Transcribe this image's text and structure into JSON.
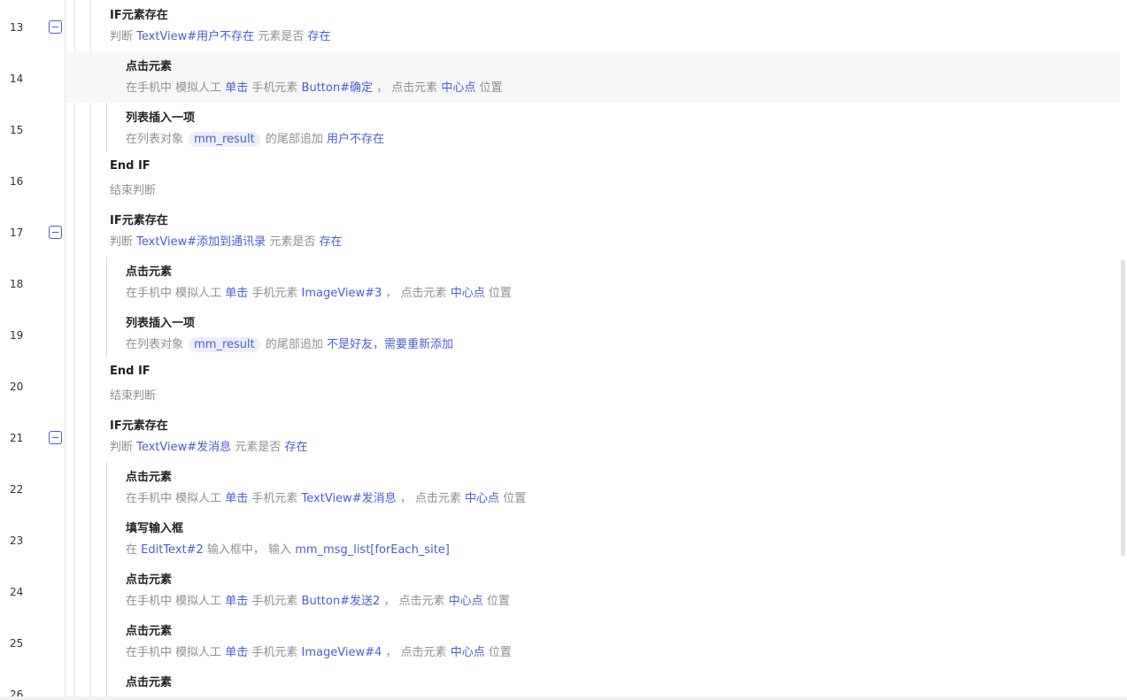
{
  "rows": [
    {
      "line": "13",
      "title": "IF元素存在",
      "desc": [
        [
          "判断 ",
          ""
        ],
        [
          "TextView#用户不存在",
          "k"
        ],
        [
          " 元素是否 ",
          ""
        ],
        [
          "存在",
          "k"
        ]
      ],
      "fold": true
    },
    {
      "line": "14",
      "title": "点击元素",
      "desc": [
        [
          "在手机中 模拟人工 ",
          ""
        ],
        [
          "单击",
          "k"
        ],
        [
          " 手机元素 ",
          ""
        ],
        [
          "Button#确定",
          "k"
        ],
        [
          " ， 点击元素 ",
          ""
        ],
        [
          "中心点",
          "k"
        ],
        [
          " 位置",
          ""
        ]
      ]
    },
    {
      "line": "15",
      "title": "列表插入一项",
      "desc": [
        [
          "在列表对象 ",
          ""
        ],
        [
          "mm_result",
          "chip"
        ],
        [
          " 的尾部追加 ",
          ""
        ],
        [
          "用户不存在",
          "k"
        ]
      ]
    },
    {
      "line": "16",
      "title": "End IF",
      "desc": [
        [
          "结束判断",
          ""
        ]
      ]
    },
    {
      "line": "17",
      "title": "IF元素存在",
      "desc": [
        [
          "判断 ",
          ""
        ],
        [
          "TextView#添加到通讯录",
          "k"
        ],
        [
          " 元素是否 ",
          ""
        ],
        [
          "存在",
          "k"
        ]
      ],
      "fold": true
    },
    {
      "line": "18",
      "title": "点击元素",
      "desc": [
        [
          "在手机中 模拟人工 ",
          ""
        ],
        [
          "单击",
          "k"
        ],
        [
          " 手机元素 ",
          ""
        ],
        [
          "ImageView#3",
          "k"
        ],
        [
          " ， 点击元素 ",
          ""
        ],
        [
          "中心点",
          "k"
        ],
        [
          " 位置",
          ""
        ]
      ]
    },
    {
      "line": "19",
      "title": "列表插入一项",
      "desc": [
        [
          "在列表对象 ",
          ""
        ],
        [
          "mm_result",
          "chip"
        ],
        [
          " 的尾部追加 ",
          ""
        ],
        [
          "不是好友，需要重新添加",
          "k"
        ]
      ]
    },
    {
      "line": "20",
      "title": "End IF",
      "desc": [
        [
          "结束判断",
          ""
        ]
      ]
    },
    {
      "line": "21",
      "title": "IF元素存在",
      "desc": [
        [
          "判断 ",
          ""
        ],
        [
          "TextView#发消息",
          "k"
        ],
        [
          " 元素是否 ",
          ""
        ],
        [
          "存在",
          "k"
        ]
      ],
      "fold": true
    },
    {
      "line": "22",
      "title": "点击元素",
      "desc": [
        [
          "在手机中 模拟人工 ",
          ""
        ],
        [
          "单击",
          "k"
        ],
        [
          " 手机元素 ",
          ""
        ],
        [
          "TextView#发消息",
          "k"
        ],
        [
          " ， 点击元素 ",
          ""
        ],
        [
          "中心点",
          "k"
        ],
        [
          " 位置",
          ""
        ]
      ]
    },
    {
      "line": "23",
      "title": "填写输入框",
      "desc": [
        [
          "在 ",
          ""
        ],
        [
          "EditText#2",
          "k"
        ],
        [
          " 输入框中， 输入 ",
          ""
        ],
        [
          "mm_msg_list[forEach_site]",
          "k"
        ]
      ]
    },
    {
      "line": "24",
      "title": "点击元素",
      "desc": [
        [
          "在手机中 模拟人工 ",
          ""
        ],
        [
          "单击",
          "k"
        ],
        [
          " 手机元素 ",
          ""
        ],
        [
          "Button#发送2",
          "k"
        ],
        [
          " ， 点击元素 ",
          ""
        ],
        [
          "中心点",
          "k"
        ],
        [
          " 位置",
          ""
        ]
      ]
    },
    {
      "line": "25",
      "title": "点击元素",
      "desc": [
        [
          "在手机中 模拟人工 ",
          ""
        ],
        [
          "单击",
          "k"
        ],
        [
          " 手机元素 ",
          ""
        ],
        [
          "ImageView#4",
          "k"
        ],
        [
          " ， 点击元素 ",
          ""
        ],
        [
          "中心点",
          "k"
        ],
        [
          " 位置",
          ""
        ]
      ]
    },
    {
      "line": "26",
      "title": "点击元素",
      "desc": []
    }
  ]
}
